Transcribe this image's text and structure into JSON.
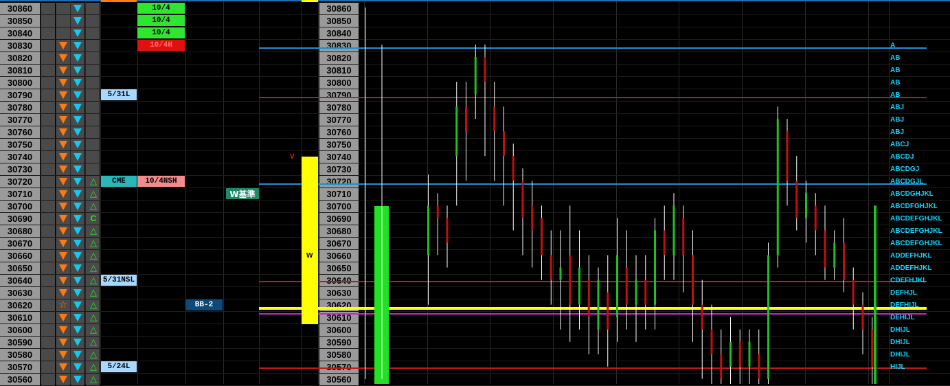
{
  "prices": [
    30860,
    30850,
    30840,
    30830,
    30820,
    30810,
    30800,
    30790,
    30780,
    30770,
    30760,
    30750,
    30740,
    30730,
    30720,
    30710,
    30700,
    30690,
    30680,
    30670,
    30660,
    30650,
    30640,
    30630,
    30620,
    30610,
    30600,
    30590,
    30580,
    30570,
    30560
  ],
  "col_orange_from": 3,
  "col_green_from": 14,
  "star_row": 24,
  "green_c_row": 17,
  "green_c_text": "C",
  "labels": [
    {
      "name": "label-10-4-a",
      "text": "10/4",
      "row": 0,
      "bg": "#2ee62e",
      "fg": "#000000",
      "col": "b"
    },
    {
      "name": "label-10-4-b",
      "text": "10/4",
      "row": 1,
      "bg": "#2ee62e",
      "fg": "#000000",
      "col": "b"
    },
    {
      "name": "label-10-4-c",
      "text": "10/4",
      "row": 2,
      "bg": "#2ee62e",
      "fg": "#000000",
      "col": "b"
    },
    {
      "name": "label-10-4h",
      "text": "10/4H",
      "row": 3,
      "bg": "#e01010",
      "fg": "#ff7070",
      "col": "b"
    },
    {
      "name": "label-5-31l",
      "text": "5/31L",
      "row": 7,
      "bg": "#a8d8ff",
      "fg": "#000000",
      "col": "a"
    },
    {
      "name": "label-cme",
      "text": "CME",
      "row": 14,
      "bg": "#2ab7b7",
      "fg": "#000000",
      "col": "a"
    },
    {
      "name": "label-10-4nsh",
      "text": "10/4NSH",
      "row": 14,
      "bg": "#f28c8c",
      "fg": "#000000",
      "col": "b"
    },
    {
      "name": "label-5-31nsl",
      "text": "5/31NSL",
      "row": 22,
      "bg": "#a8d8ff",
      "fg": "#000000",
      "col": "a"
    },
    {
      "name": "label-bb-2",
      "text": "BB-2",
      "row": 24,
      "bg": "#0e4a78",
      "fg": "#ffffff",
      "col": "c"
    },
    {
      "name": "label-5-24l",
      "text": "5/24L",
      "row": 29,
      "bg": "#a8d8ff",
      "fg": "#000000",
      "col": "a"
    }
  ],
  "w_kijun_label": "W基準",
  "w_kijun_row": 15,
  "v_marker": "V",
  "v_row": 12,
  "w_marker": "W",
  "w_bar_rows": [
    13,
    26
  ],
  "green_bar_rows": [
    16,
    30
  ],
  "profile": [
    "A",
    "AB",
    "AB",
    "AB",
    "AB",
    "ABJ",
    "ABJ",
    "ABJ",
    "ABCJ",
    "ABCDJ",
    "ABCDGJ",
    "ABCDGJL",
    "ABCDGHJKL",
    "ABCDFGHJKL",
    "ABCDEFGHJKL",
    "ABCDEFGHJKL",
    "ABCDEFGHJKL",
    "ADDEFHJKL",
    "ADDEFHJKL",
    "CDEFHJKL",
    "DEFHJL",
    "DEFHIJL",
    "DEHIJL",
    "DHIJL",
    "DHIJL",
    "DHIJL",
    "HIJL"
  ],
  "profile_start_row": 3,
  "h_lines": [
    {
      "row": 3.6,
      "color": "#1e90d0"
    },
    {
      "row": 7.6,
      "color": "#c01818"
    },
    {
      "row": 14.6,
      "color": "#1e90d0"
    },
    {
      "row": 22.5,
      "color": "#c01818"
    },
    {
      "row": 24.6,
      "color": "#ffff00"
    },
    {
      "row": 25.1,
      "color": "#d020d0"
    },
    {
      "row": 29.5,
      "color": "#c01818"
    }
  ],
  "chart_data": {
    "type": "candlestick",
    "ylim": [
      30556,
      30866
    ],
    "candles": [
      [
        30660,
        30700,
        30620,
        30725
      ],
      [
        30700,
        30690,
        30660,
        30710
      ],
      [
        30690,
        30670,
        30650,
        30700
      ],
      [
        30740,
        30780,
        30700,
        30800
      ],
      [
        30780,
        30760,
        30720,
        30800
      ],
      [
        30790,
        30820,
        30770,
        30830
      ],
      [
        30820,
        30800,
        30740,
        30830
      ],
      [
        30780,
        30760,
        30720,
        30800
      ],
      [
        30760,
        30740,
        30700,
        30780
      ],
      [
        30740,
        30720,
        30680,
        30750
      ],
      [
        30720,
        30690,
        30660,
        30730
      ],
      [
        30700,
        30680,
        30650,
        30720
      ],
      [
        30690,
        30660,
        30640,
        30700
      ],
      [
        30660,
        30640,
        30620,
        30680
      ],
      [
        30640,
        30650,
        30600,
        30680
      ],
      [
        30660,
        30620,
        30590,
        30700
      ],
      [
        30620,
        30650,
        30600,
        30680
      ],
      [
        30640,
        30610,
        30580,
        30660
      ],
      [
        30600,
        30640,
        30580,
        30650
      ],
      [
        30630,
        30600,
        30570,
        30660
      ],
      [
        30610,
        30660,
        30590,
        30690
      ],
      [
        30650,
        30620,
        30600,
        30680
      ],
      [
        30620,
        30640,
        30590,
        30660
      ],
      [
        30640,
        30620,
        30600,
        30660
      ],
      [
        30620,
        30680,
        30600,
        30690
      ],
      [
        30680,
        30660,
        30640,
        30700
      ],
      [
        30660,
        30700,
        30640,
        30710
      ],
      [
        30690,
        30660,
        30630,
        30700
      ],
      [
        30660,
        30620,
        30590,
        30680
      ],
      [
        30620,
        30600,
        30560,
        30640
      ],
      [
        30600,
        30580,
        30540,
        30620
      ],
      [
        30580,
        30560,
        30530,
        30600
      ],
      [
        30570,
        30590,
        30540,
        30610
      ],
      [
        30590,
        30570,
        30520,
        30600
      ],
      [
        30570,
        30590,
        30540,
        30600
      ],
      [
        30580,
        30560,
        30530,
        30600
      ],
      [
        30560,
        30660,
        30550,
        30670
      ],
      [
        30660,
        30770,
        30650,
        30780
      ],
      [
        30760,
        30720,
        30700,
        30770
      ],
      [
        30720,
        30690,
        30680,
        30740
      ],
      [
        30690,
        30710,
        30670,
        30720
      ],
      [
        30700,
        30680,
        30660,
        30710
      ],
      [
        30680,
        30650,
        30640,
        30700
      ],
      [
        30650,
        30670,
        30640,
        30680
      ],
      [
        30670,
        30640,
        30630,
        30690
      ],
      [
        30640,
        30620,
        30600,
        30650
      ],
      [
        30620,
        30600,
        30580,
        30630
      ],
      [
        30600,
        30570,
        30550,
        30610
      ]
    ]
  }
}
